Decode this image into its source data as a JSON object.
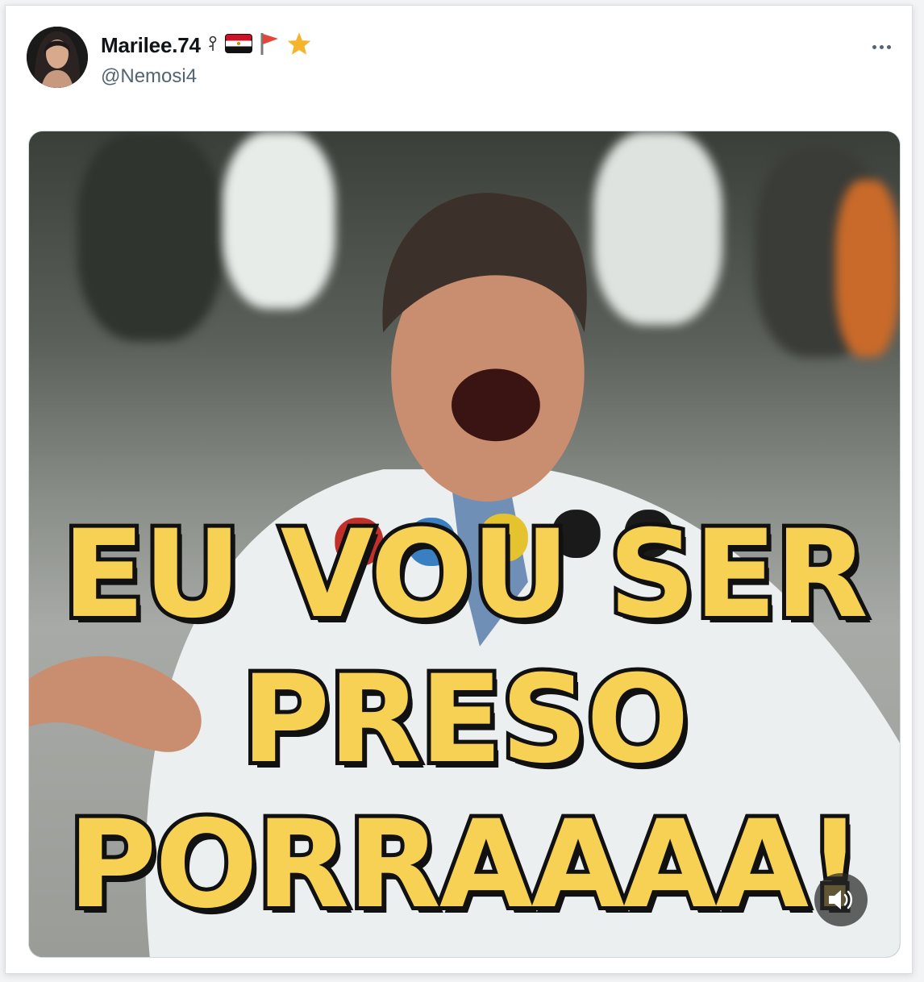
{
  "post": {
    "author": {
      "display_name": "Marilee.74",
      "handle": "@Nemosi4",
      "badges": [
        "rose-icon",
        "egypt-flag-icon",
        "red-flag-icon",
        "star-icon"
      ],
      "avatar": "avatar"
    },
    "more_icon": "ellipsis-icon",
    "media": {
      "caption_lines": [
        "EU VOU SER",
        "PRESO",
        "PORRAAAA!"
      ],
      "caption_color": "#f7d154",
      "sound_icon": "speaker-icon"
    }
  }
}
